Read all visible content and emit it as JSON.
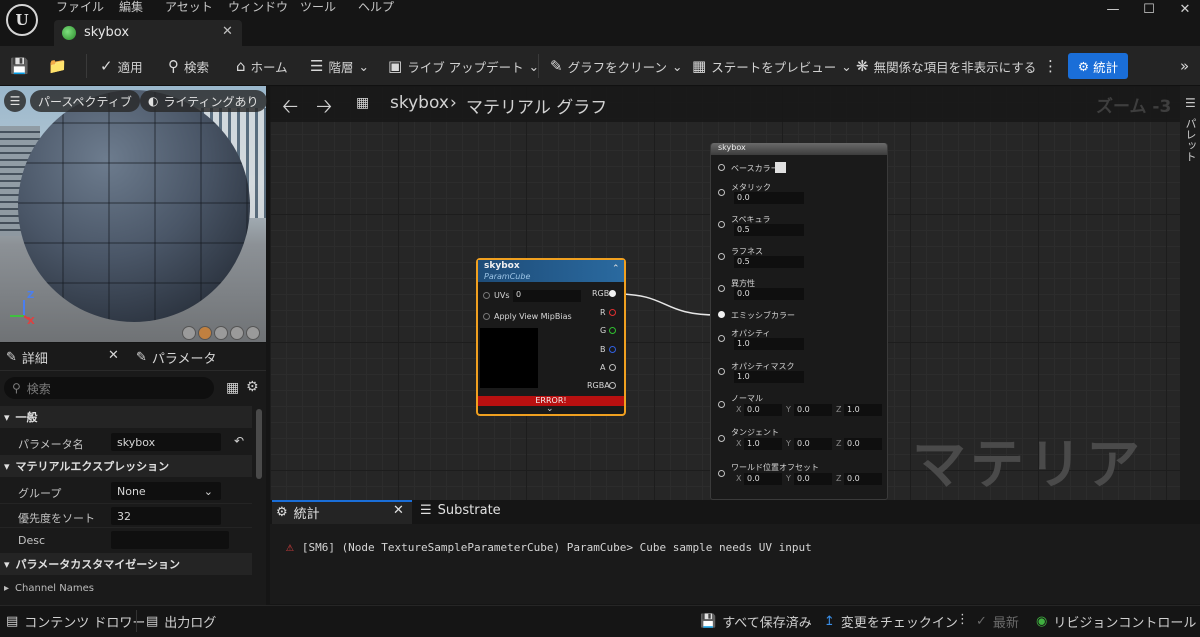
{
  "menu": [
    "ファイル",
    "編集",
    "アセット",
    "ウィンドウ",
    "ツール",
    "ヘルプ"
  ],
  "logo_text": "U",
  "window_controls": [
    "—",
    "☐",
    "✕"
  ],
  "tab": {
    "label": "skybox",
    "close": "✕"
  },
  "toolbar": {
    "apply": "適用",
    "search": "検索",
    "home": "ホーム",
    "hierarchy": "階層",
    "live_update": "ライブ アップデート",
    "clean_graph": "グラフをクリーン",
    "preview_state": "ステートをプレビュー",
    "hide_unrelated": "無関係な項目を非表示にする",
    "stats": "統計"
  },
  "viewport": {
    "perspective": "パースペクティブ",
    "lighting": "ライティングあり",
    "axis_z": "Z",
    "axis_x": "X"
  },
  "details": {
    "tab_details": "詳細",
    "tab_params": "パラメータ",
    "search_placeholder": "検索",
    "section_general": "一般",
    "param_name_label": "パラメータ名",
    "param_name_value": "skybox",
    "section_mat_expr": "マテリアルエクスプレッション",
    "group_label": "グループ",
    "group_value": "None",
    "sort_priority_label": "優先度をソート",
    "sort_priority_value": "32",
    "desc_label": "Desc",
    "desc_value": "",
    "section_customize": "パラメータカスタマイゼーション",
    "channel_names": "Channel Names"
  },
  "graph": {
    "breadcrumb_root": "skybox",
    "breadcrumb_sep": "›",
    "breadcrumb_child": "マテリアル グラフ",
    "zoom": "ズーム -3",
    "watermark": "マテリアル",
    "palette": "パレット"
  },
  "param_node": {
    "title": "skybox",
    "subtitle": "ParamCube",
    "uvs_label": "UVs",
    "uvs_value": "0",
    "mipbias_label": "Apply View MipBias",
    "outputs": [
      "RGB",
      "R",
      "G",
      "B",
      "A",
      "RGBA"
    ],
    "error": "ERROR!",
    "colors": {
      "border": "#f0a020",
      "header": "#2a6aa0",
      "error": "#b81010"
    }
  },
  "material_node": {
    "title": "skybox",
    "base_color": "ベースカラー",
    "metallic": {
      "label": "メタリック",
      "value": "0.0"
    },
    "specular": {
      "label": "スペキュラ",
      "value": "0.5"
    },
    "roughness": {
      "label": "ラフネス",
      "value": "0.5"
    },
    "anisotropy": {
      "label": "異方性",
      "value": "0.0"
    },
    "emissive": "エミッシブカラー",
    "opacity": {
      "label": "オパシティ",
      "value": "1.0"
    },
    "opacity_mask": {
      "label": "オパシティマスク",
      "value": "1.0"
    },
    "normal": {
      "label": "ノーマル",
      "x": "0.0",
      "y": "0.0",
      "z": "1.0"
    },
    "tangent": {
      "label": "タンジェント",
      "x": "1.0",
      "y": "0.0",
      "z": "0.0"
    },
    "world_offset": {
      "label": "ワールド位置オフセット",
      "x": "0.0",
      "y": "0.0",
      "z": "0.0"
    },
    "axis_x": "X",
    "axis_y": "Y",
    "axis_z": "Z"
  },
  "stats_panel": {
    "tab_stats": "統計",
    "tab_close": "✕",
    "tab_substrate": "Substrate",
    "error_message": "[SM6] (Node TextureSampleParameterCube) ParamCube> Cube sample needs UV input"
  },
  "statusbar": {
    "content_drawer": "コンテンツ ドロワー",
    "output_log": "出力ログ",
    "all_saved": "すべて保存済み",
    "checkin": "変更をチェックイン",
    "latest": "最新",
    "revision_control": "リビジョンコントロール"
  }
}
